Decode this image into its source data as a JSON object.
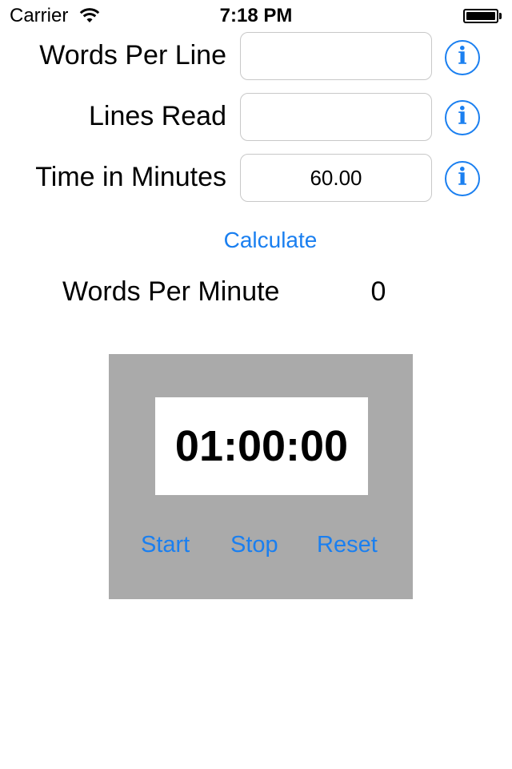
{
  "status_bar": {
    "carrier": "Carrier",
    "time": "7:18 PM",
    "icons": [
      "wifi-icon",
      "battery-icon"
    ]
  },
  "form": {
    "words_per_line": {
      "label": "Words Per Line",
      "value": "",
      "info_icon": "info-icon"
    },
    "lines_read": {
      "label": "Lines Read",
      "value": "",
      "info_icon": "info-icon"
    },
    "time_in_minutes": {
      "label": "Time in Minutes",
      "value": "60.00",
      "info_icon": "info-icon"
    }
  },
  "calculate_label": "Calculate",
  "result": {
    "label": "Words Per Minute",
    "value": "0"
  },
  "stopwatch": {
    "display": "01:00:00",
    "start_label": "Start",
    "stop_label": "Stop",
    "reset_label": "Reset"
  },
  "colors": {
    "accent": "#1a7ff0",
    "panel": "#aaaaaa",
    "field_border": "#c8c8c8"
  }
}
